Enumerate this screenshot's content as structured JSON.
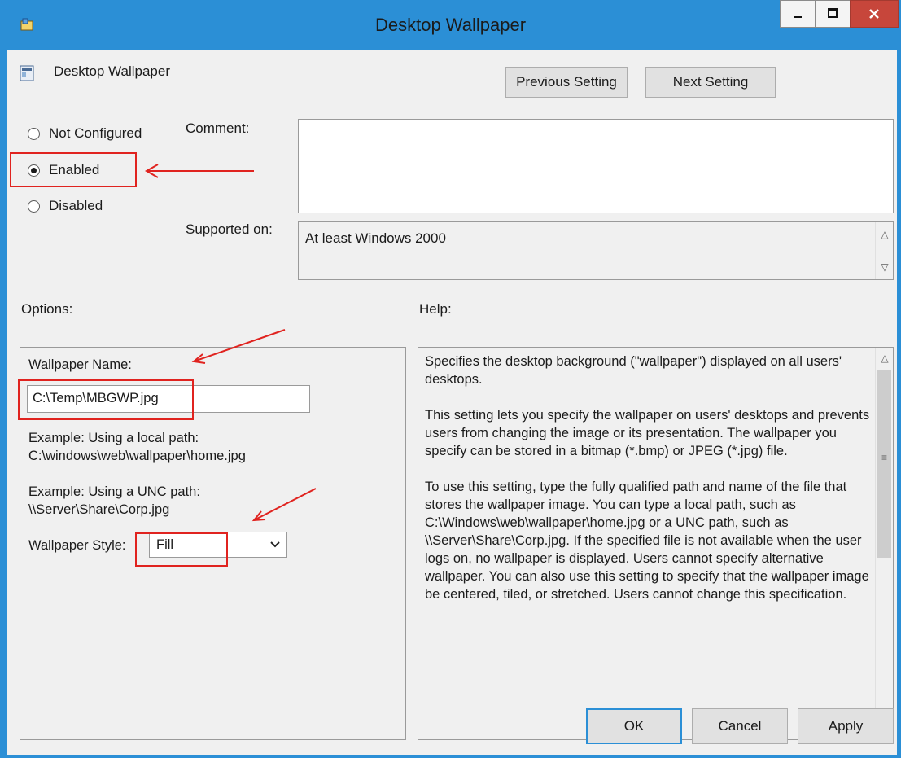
{
  "window": {
    "title": "Desktop Wallpaper",
    "accent_color": "#2b8fd6",
    "controls": {
      "minimize_icon": "minimize-icon",
      "maximize_icon": "maximize-icon",
      "close_icon": "close-icon"
    }
  },
  "header": {
    "policy_name": "Desktop Wallpaper",
    "prev_label": "Previous Setting",
    "next_label": "Next Setting"
  },
  "state": {
    "options": [
      "Not Configured",
      "Enabled",
      "Disabled"
    ],
    "selected": "Enabled"
  },
  "comment": {
    "label": "Comment:",
    "value": ""
  },
  "supported": {
    "label": "Supported on:",
    "value": "At least Windows 2000"
  },
  "options_panel": {
    "label": "Options:",
    "wallpaper_name_label": "Wallpaper Name:",
    "wallpaper_name_value": "C:\\Temp\\MBGWP.jpg",
    "example_local_title": "Example: Using a local path:",
    "example_local_path": "C:\\windows\\web\\wallpaper\\home.jpg",
    "example_unc_title": "Example: Using a UNC path:",
    "example_unc_path": "\\\\Server\\Share\\Corp.jpg",
    "style_label": "Wallpaper Style:",
    "style_value": "Fill"
  },
  "help_panel": {
    "label": "Help:",
    "paragraphs": [
      "Specifies the desktop background (\"wallpaper\") displayed on all users' desktops.",
      "This setting lets you specify the wallpaper on users' desktops and prevents users from changing the image or its presentation. The wallpaper you specify can be stored in a bitmap (*.bmp) or JPEG (*.jpg) file.",
      "To use this setting, type the fully qualified path and name of the file that stores the wallpaper image. You can type a local path, such as C:\\Windows\\web\\wallpaper\\home.jpg or a UNC path, such as \\\\Server\\Share\\Corp.jpg. If the specified file is not available when the user logs on, no wallpaper is displayed. Users cannot specify alternative wallpaper. You can also use this setting to specify that the wallpaper image be centered, tiled, or stretched. Users cannot change this specification."
    ]
  },
  "footer": {
    "ok_label": "OK",
    "cancel_label": "Cancel",
    "apply_label": "Apply"
  },
  "annotation_color": "#e0231f"
}
